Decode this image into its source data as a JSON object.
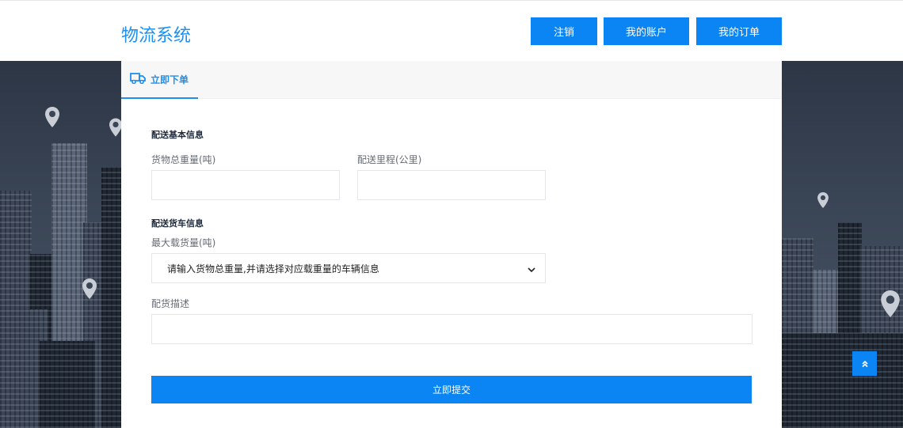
{
  "header": {
    "logo": "物流系统",
    "nav": {
      "logout": "注销",
      "account": "我的账户",
      "orders": "我的订单"
    }
  },
  "tab": {
    "label": "立即下单",
    "icon": "truck-icon"
  },
  "form": {
    "basic_section": "配送基本信息",
    "weight_label": "货物总重量(吨)",
    "weight_value": "",
    "distance_label": "配送里程(公里)",
    "distance_value": "",
    "truck_section": "配送货车信息",
    "capacity_label": "最大载货量(吨)",
    "capacity_selected": "请输入货物总重量,并请选择对应载重量的车辆信息",
    "desc_label": "配货描述",
    "desc_value": "",
    "submit_label": "立即提交"
  },
  "colors": {
    "accent": "#0a85f3",
    "logo": "#1d8ff1",
    "background_dark": "#2d3645"
  },
  "icons": {
    "back_to_top": "double-chevron-up-icon",
    "map_pin": "map-pin-icon",
    "select_arrow": "chevron-down-icon"
  }
}
